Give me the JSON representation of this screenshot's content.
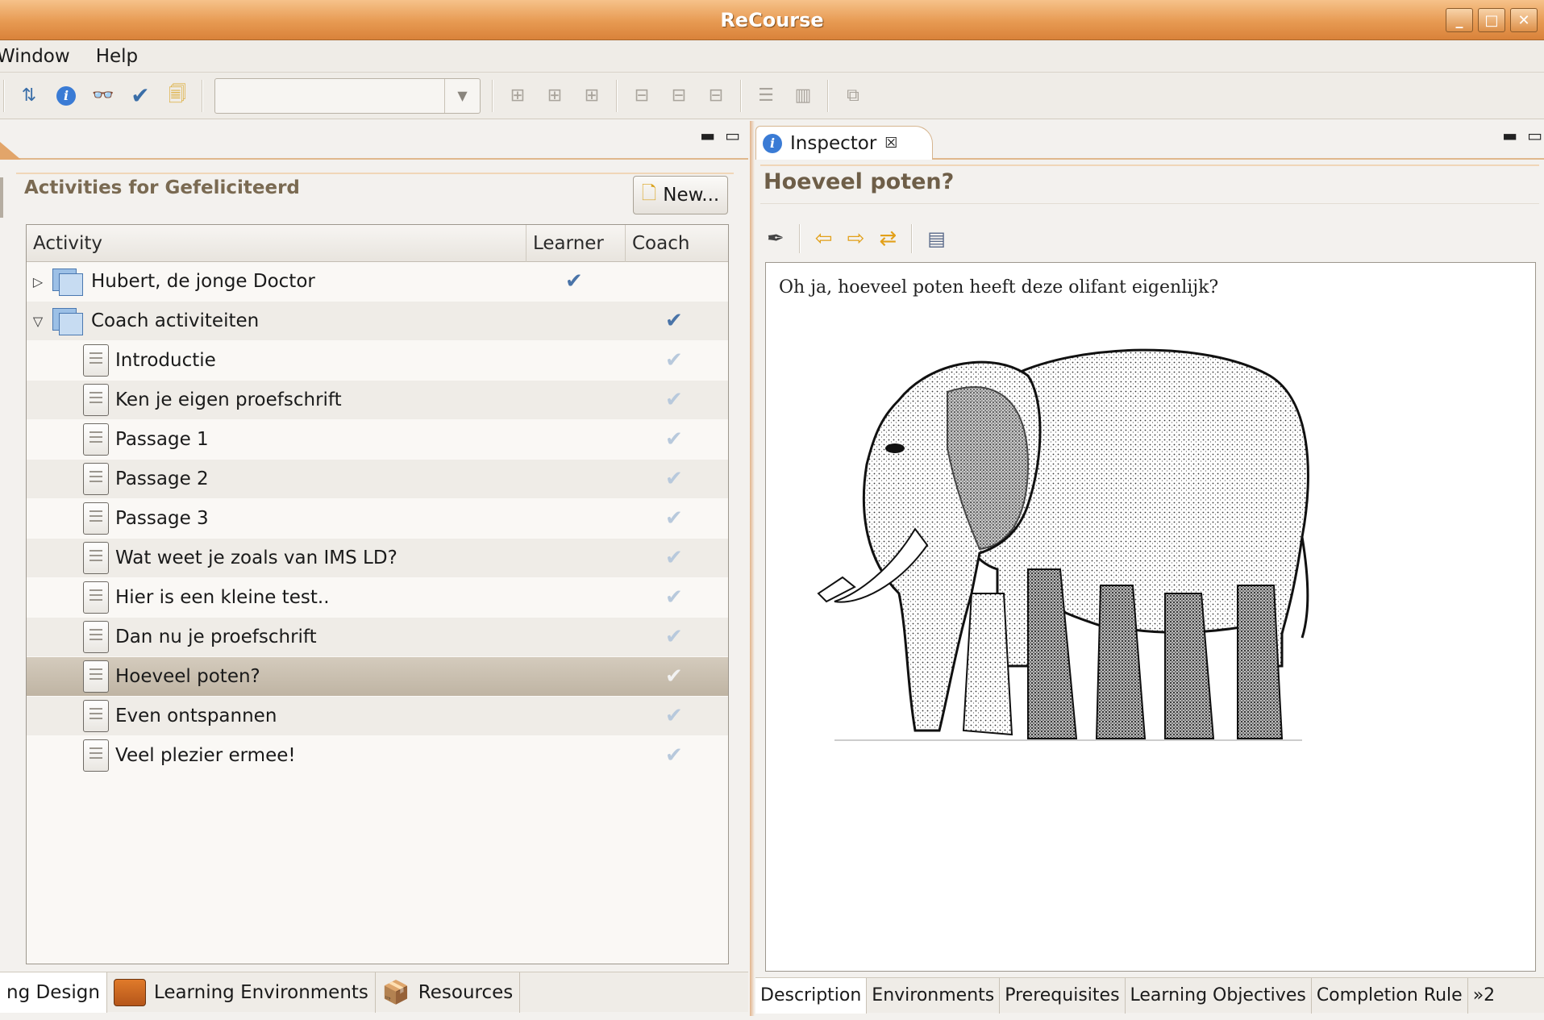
{
  "window": {
    "title": "ReCourse",
    "controls": [
      "_",
      "□",
      "✕"
    ]
  },
  "menu": [
    {
      "label": "Window"
    },
    {
      "label": "Help"
    }
  ],
  "toolbar": {
    "combo_value": ""
  },
  "left": {
    "panel_title": "Activities for Gefeliciteerd",
    "new_button": "New...",
    "columns": [
      "Activity",
      "Learner",
      "Coach"
    ],
    "rows": [
      {
        "label": "Hubert, de jonge Doctor",
        "kind": "structure",
        "expander": "▷",
        "learner": true,
        "coach": false
      },
      {
        "label": "Coach activiteiten",
        "kind": "structure",
        "expander": "▽",
        "learner": false,
        "coach": true
      },
      {
        "label": "Introductie",
        "kind": "activity",
        "learner": false,
        "coach": true
      },
      {
        "label": "Ken je eigen proefschrift",
        "kind": "activity",
        "learner": false,
        "coach": true
      },
      {
        "label": "Passage 1",
        "kind": "activity",
        "learner": false,
        "coach": true
      },
      {
        "label": "Passage 2",
        "kind": "activity",
        "learner": false,
        "coach": true
      },
      {
        "label": "Passage 3",
        "kind": "activity",
        "learner": false,
        "coach": true
      },
      {
        "label": "Wat weet je zoals van IMS LD?",
        "kind": "activity",
        "learner": false,
        "coach": true
      },
      {
        "label": "Hier is een kleine test..",
        "kind": "activity",
        "learner": false,
        "coach": true
      },
      {
        "label": "Dan nu je proefschrift",
        "kind": "activity",
        "learner": false,
        "coach": true
      },
      {
        "label": "Hoeveel poten?",
        "kind": "activity",
        "learner": false,
        "coach": true,
        "selected": true
      },
      {
        "label": "Even ontspannen",
        "kind": "activity",
        "learner": false,
        "coach": true
      },
      {
        "label": "Veel plezier ermee!",
        "kind": "activity",
        "learner": false,
        "coach": true
      }
    ],
    "bottom_tabs": [
      "ng Design",
      "Learning Environments",
      "Resources"
    ]
  },
  "right": {
    "tab_label": "Inspector",
    "title": "Hoeveel poten?",
    "description": "Oh ja, hoeveel poten heeft deze olifant eigenlijk?",
    "bottom_tabs": [
      "Description",
      "Environments",
      "Prerequisites",
      "Learning Objectives",
      "Completion Rule",
      "»2"
    ]
  }
}
